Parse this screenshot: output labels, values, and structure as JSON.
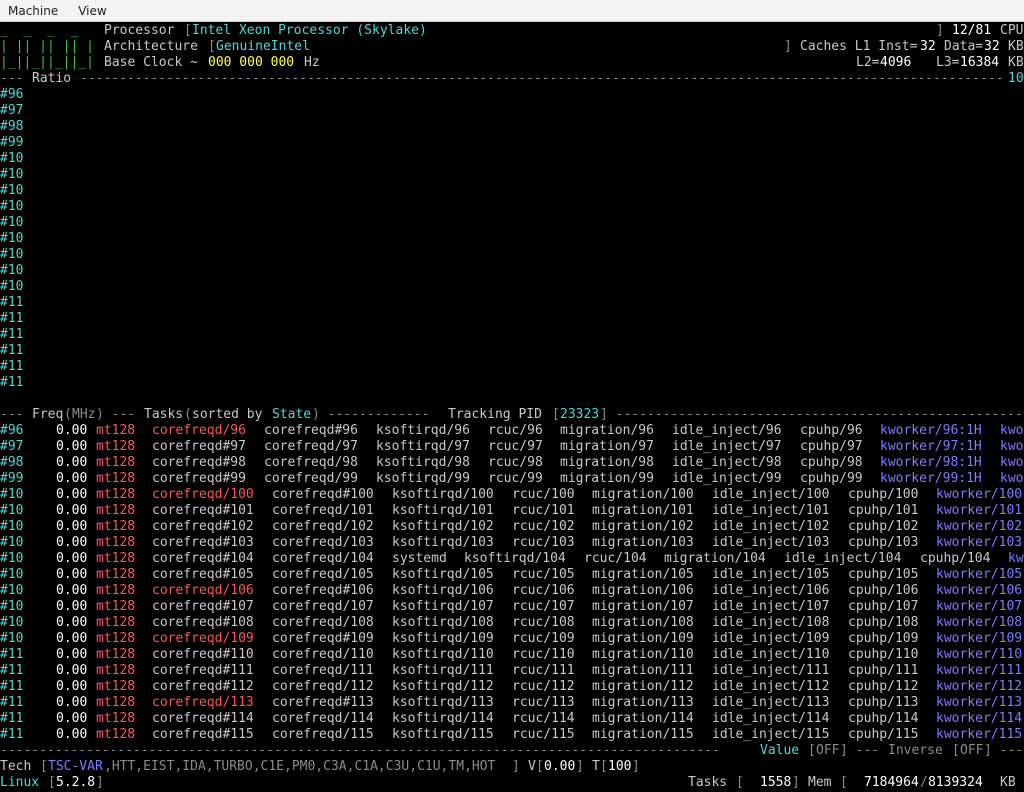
{
  "menu": {
    "machine": "Machine",
    "view": "View"
  },
  "header": {
    "logo": [
      "_  _  _  _",
      "| || || || |",
      "|_||_||_||_|"
    ],
    "processor_label": "Processor",
    "processor_value": "Intel Xeon Processor (Skylake)",
    "cpu_count": "12/81",
    "cpu_label": "CPU",
    "arch_label": "Architecture",
    "arch_value": "GenuineIntel",
    "caches_label": "Caches L1 Inst=",
    "l1_inst": "32",
    "data_label": "Data=",
    "l1_data": "32",
    "kb": "KB",
    "base_clock_label": "Base Clock ~",
    "base_clock_value": "000 000 000",
    "hz": "Hz",
    "l2_label": "L2=",
    "l2_value": "4096",
    "l3_label": "L3=",
    "l3_value": "16384",
    "kb2": "KB"
  },
  "ratio": {
    "label": "Ratio",
    "right_value": "10",
    "cores": [
      "#96",
      "#97",
      "#98",
      "#99",
      "#10",
      "#10",
      "#10",
      "#10",
      "#10",
      "#10",
      "#10",
      "#10",
      "#10",
      "#11",
      "#11",
      "#11",
      "#11",
      "#11",
      "#11"
    ]
  },
  "tasks_header": {
    "freq": "Freq",
    "mhz": "MHz",
    "tasks": "Tasks",
    "sorted_by": "sorted by",
    "state": "State",
    "tracking": "Tracking PID",
    "pid": "23323"
  },
  "task_rows": [
    {
      "core": "#96",
      "freq": "0.00",
      "mt": "mt128",
      "c1": "corefreqd/96",
      "c1_red": true,
      "cols": [
        "corefreqd#96",
        "ksoftirqd/96",
        "rcuc/96",
        "migration/96",
        "idle_inject/96",
        "cpuhp/96"
      ],
      "kw": "kworker/96:1H",
      "tail": "kwo"
    },
    {
      "core": "#97",
      "freq": "0.00",
      "mt": "mt128",
      "c1": "corefreqd#97",
      "c1_red": false,
      "cols": [
        "corefreqd/97",
        "ksoftirqd/97",
        "rcuc/97",
        "migration/97",
        "idle_inject/97",
        "cpuhp/97"
      ],
      "kw": "kworker/97:1H",
      "tail": "kwo"
    },
    {
      "core": "#98",
      "freq": "0.00",
      "mt": "mt128",
      "c1": "corefreqd#98",
      "c1_red": false,
      "cols": [
        "corefreqd/98",
        "ksoftirqd/98",
        "rcuc/98",
        "migration/98",
        "idle_inject/98",
        "cpuhp/98"
      ],
      "kw": "kworker/98:1H",
      "tail": "kwo"
    },
    {
      "core": "#99",
      "freq": "0.00",
      "mt": "mt128",
      "c1": "corefreqd#99",
      "c1_red": false,
      "cols": [
        "corefreqd/99",
        "ksoftirqd/99",
        "rcuc/99",
        "migration/99",
        "idle_inject/99",
        "cpuhp/99"
      ],
      "kw": "kworker/99:1H",
      "tail": "kwo"
    },
    {
      "core": "#10",
      "freq": "0.00",
      "mt": "mt128",
      "c1": "corefreqd/100",
      "c1_red": true,
      "cols": [
        "corefreqd#100",
        "ksoftirqd/100",
        "rcuc/100",
        "migration/100",
        "idle_inject/100",
        "cpuhp/100"
      ],
      "kw": "kworker/100",
      "tail": ""
    },
    {
      "core": "#10",
      "freq": "0.00",
      "mt": "mt128",
      "c1": "corefreqd#101",
      "c1_red": false,
      "cols": [
        "corefreqd/101",
        "ksoftirqd/101",
        "rcuc/101",
        "migration/101",
        "idle_inject/101",
        "cpuhp/101"
      ],
      "kw": "kworker/101",
      "tail": ""
    },
    {
      "core": "#10",
      "freq": "0.00",
      "mt": "mt128",
      "c1": "corefreqd#102",
      "c1_red": false,
      "cols": [
        "corefreqd/102",
        "ksoftirqd/102",
        "rcuc/102",
        "migration/102",
        "idle_inject/102",
        "cpuhp/102"
      ],
      "kw": "kworker/102",
      "tail": ""
    },
    {
      "core": "#10",
      "freq": "0.00",
      "mt": "mt128",
      "c1": "corefreqd#103",
      "c1_red": false,
      "cols": [
        "corefreqd/103",
        "ksoftirqd/103",
        "rcuc/103",
        "migration/103",
        "idle_inject/103",
        "cpuhp/103"
      ],
      "kw": "kworker/103",
      "tail": ""
    },
    {
      "core": "#10",
      "freq": "0.00",
      "mt": "mt128",
      "c1": "corefreqd#104",
      "c1_red": false,
      "special": true,
      "cols": [
        "corefreqd/104",
        "systemd",
        "ksoftirqd/104",
        "rcuc/104",
        "migration/104",
        "idle_inject/104",
        "cpuhp/104"
      ],
      "kw": "",
      "tail": "kw"
    },
    {
      "core": "#10",
      "freq": "0.00",
      "mt": "mt128",
      "c1": "corefreqd#105",
      "c1_red": false,
      "cols": [
        "corefreqd/105",
        "ksoftirqd/105",
        "rcuc/105",
        "migration/105",
        "idle_inject/105",
        "cpuhp/105"
      ],
      "kw": "kworker/105",
      "tail": ""
    },
    {
      "core": "#10",
      "freq": "0.00",
      "mt": "mt128",
      "c1": "corefreqd/106",
      "c1_red": true,
      "cols": [
        "corefreqd#106",
        "ksoftirqd/106",
        "rcuc/106",
        "migration/106",
        "idle_inject/106",
        "cpuhp/106"
      ],
      "kw": "kworker/106",
      "tail": ""
    },
    {
      "core": "#10",
      "freq": "0.00",
      "mt": "mt128",
      "c1": "corefreqd#107",
      "c1_red": false,
      "cols": [
        "corefreqd/107",
        "ksoftirqd/107",
        "rcuc/107",
        "migration/107",
        "idle_inject/107",
        "cpuhp/107"
      ],
      "kw": "kworker/107",
      "tail": ""
    },
    {
      "core": "#10",
      "freq": "0.00",
      "mt": "mt128",
      "c1": "corefreqd#108",
      "c1_red": false,
      "cols": [
        "corefreqd/108",
        "ksoftirqd/108",
        "rcuc/108",
        "migration/108",
        "idle_inject/108",
        "cpuhp/108"
      ],
      "kw": "kworker/108",
      "tail": ""
    },
    {
      "core": "#10",
      "freq": "0.00",
      "mt": "mt128",
      "c1": "corefreqd/109",
      "c1_red": true,
      "cols": [
        "corefreqd#109",
        "ksoftirqd/109",
        "rcuc/109",
        "migration/109",
        "idle_inject/109",
        "cpuhp/109"
      ],
      "kw": "kworker/109",
      "tail": ""
    },
    {
      "core": "#11",
      "freq": "0.00",
      "mt": "mt128",
      "c1": "corefreqd#110",
      "c1_red": false,
      "cols": [
        "corefreqd/110",
        "ksoftirqd/110",
        "rcuc/110",
        "migration/110",
        "idle_inject/110",
        "cpuhp/110"
      ],
      "kw": "kworker/110",
      "tail": ""
    },
    {
      "core": "#11",
      "freq": "0.00",
      "mt": "mt128",
      "c1": "corefreqd#111",
      "c1_red": false,
      "cols": [
        "corefreqd/111",
        "ksoftirqd/111",
        "rcuc/111",
        "migration/111",
        "idle_inject/111",
        "cpuhp/111"
      ],
      "kw": "kworker/111",
      "tail": ""
    },
    {
      "core": "#11",
      "freq": "0.00",
      "mt": "mt128",
      "c1": "corefreqd#112",
      "c1_red": false,
      "cols": [
        "corefreqd/112",
        "ksoftirqd/112",
        "rcuc/112",
        "migration/112",
        "idle_inject/112",
        "cpuhp/112"
      ],
      "kw": "kworker/112",
      "tail": ""
    },
    {
      "core": "#11",
      "freq": "0.00",
      "mt": "mt128",
      "c1": "corefreqd/113",
      "c1_red": true,
      "cols": [
        "corefreqd#113",
        "ksoftirqd/113",
        "rcuc/113",
        "migration/113",
        "idle_inject/113",
        "cpuhp/113"
      ],
      "kw": "kworker/113",
      "tail": ""
    },
    {
      "core": "#11",
      "freq": "0.00",
      "mt": "mt128",
      "c1": "corefreqd#114",
      "c1_red": false,
      "cols": [
        "corefreqd/114",
        "ksoftirqd/114",
        "rcuc/114",
        "migration/114",
        "idle_inject/114",
        "cpuhp/114"
      ],
      "kw": "kworker/114",
      "tail": ""
    },
    {
      "core": "#11",
      "freq": "0.00",
      "mt": "mt128",
      "c1": "corefreqd#115",
      "c1_red": false,
      "cols": [
        "corefreqd/115",
        "ksoftirqd/115",
        "rcuc/115",
        "migration/115",
        "idle_inject/115",
        "cpuhp/115"
      ],
      "kw": "kworker/115",
      "tail": ""
    }
  ],
  "bottom_bar": {
    "value_label": "Value",
    "value_state": "OFF",
    "inverse_label": "Inverse",
    "inverse_state": "OFF"
  },
  "tech": {
    "label": "Tech",
    "tsc": "TSC-VAR",
    "features": ",HTT,EIST,IDA,TURBO,C1E,PM0,C3A,C1A,C3U,C1U,TM,HOT",
    "v_label": "V",
    "v_value": "0.00",
    "t_label": "T",
    "t_value": "100"
  },
  "status": {
    "os": "Linux",
    "kernel": "5.2.8",
    "tasks_label": "Tasks",
    "tasks_value": "1558",
    "mem_label": "Mem",
    "mem_used": "7184964",
    "mem_total": "8139324",
    "kb": "KB"
  }
}
